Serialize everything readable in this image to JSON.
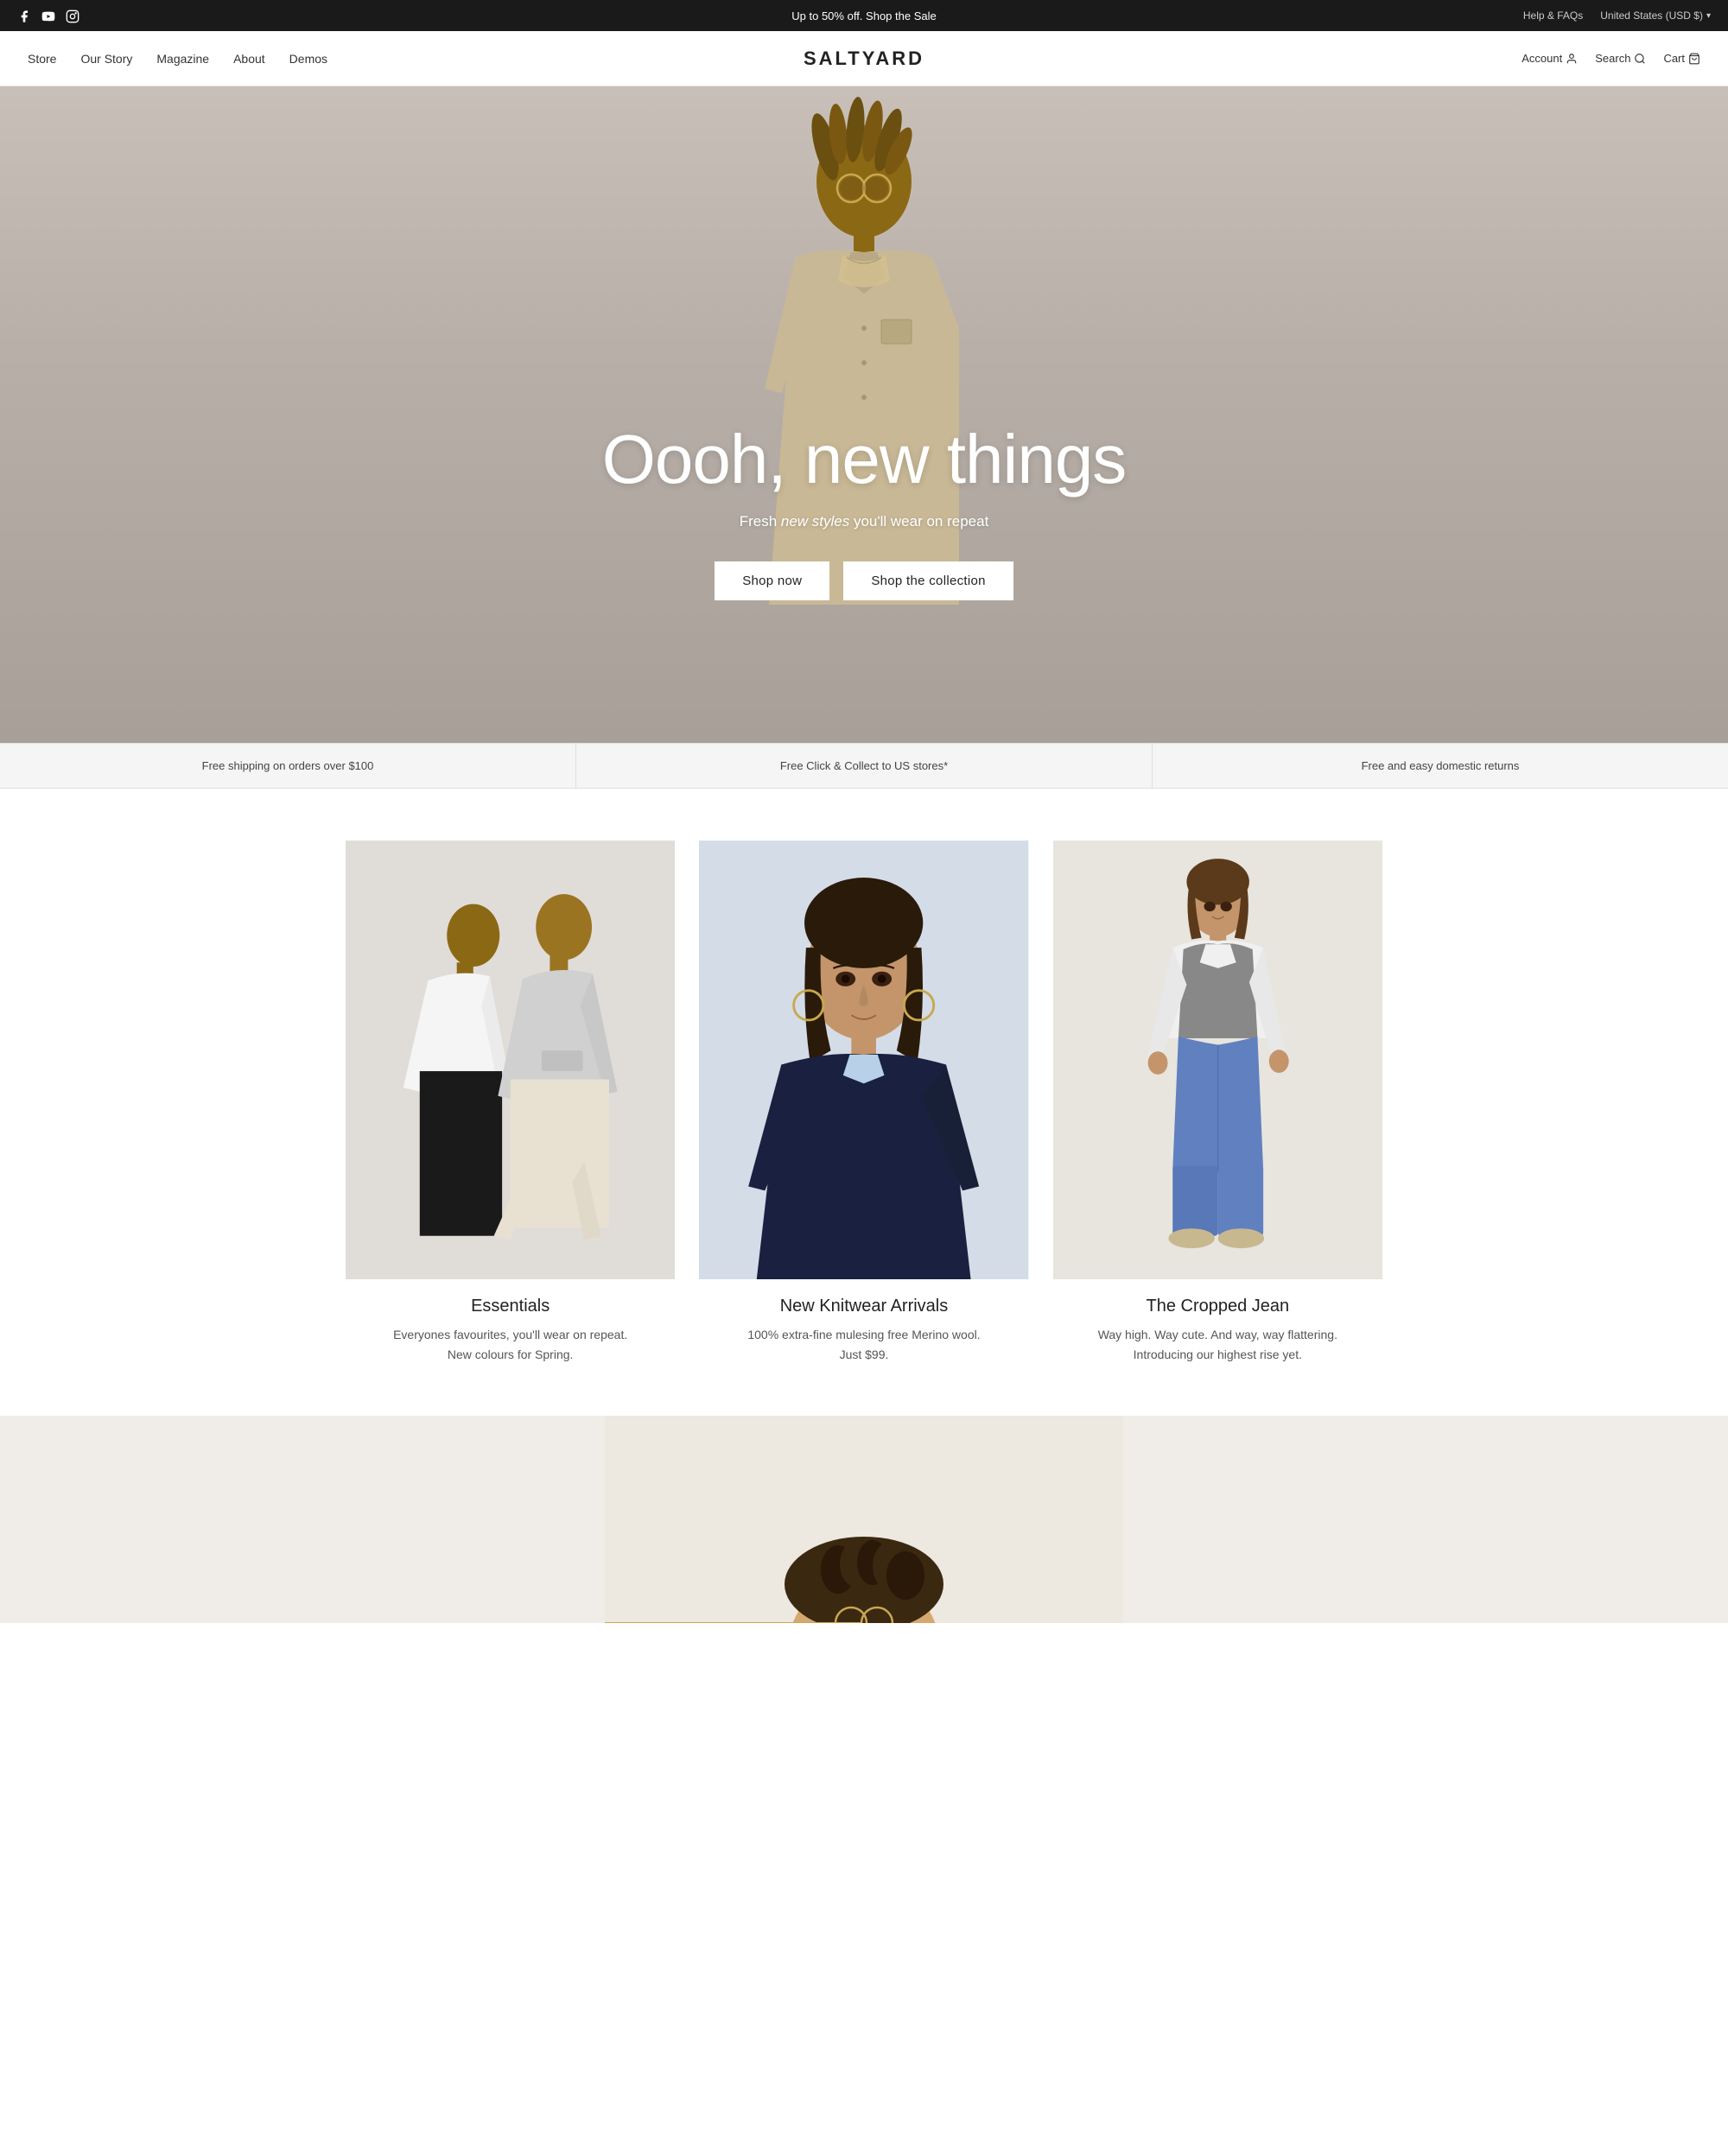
{
  "announcement": {
    "sale_text": "Up to 50% off. ",
    "sale_link": "Shop the Sale",
    "help_link": "Help & FAQs",
    "currency": "United States (USD $)",
    "currency_arrow": "▾"
  },
  "social": {
    "facebook": "f",
    "youtube": "▶",
    "instagram": "◻"
  },
  "nav": {
    "logo": "SALTYARD",
    "left_links": [
      {
        "label": "Store",
        "id": "store"
      },
      {
        "label": "Our Story",
        "id": "our-story"
      },
      {
        "label": "Magazine",
        "id": "magazine"
      },
      {
        "label": "About",
        "id": "about"
      },
      {
        "label": "Demos",
        "id": "demos"
      }
    ],
    "right_links": [
      {
        "label": "Account",
        "id": "account"
      },
      {
        "label": "Search",
        "id": "search"
      },
      {
        "label": "Cart",
        "id": "cart"
      }
    ]
  },
  "hero": {
    "title": "Oooh, new things",
    "subtitle_before": "Fresh ",
    "subtitle_italic": "new styles",
    "subtitle_after": " you'll wear on repeat",
    "btn_shop_now": "Shop now",
    "btn_shop_collection": "Shop the collection"
  },
  "info_bar": [
    {
      "text": "Free shipping on orders over $100"
    },
    {
      "text": "Free Click & Collect to US stores*"
    },
    {
      "text": "Free and easy domestic returns"
    }
  ],
  "products": [
    {
      "name": "Essentials",
      "desc": "Everyones favourites, you'll wear on repeat.\nNew colours for Spring.",
      "bg_top": "#c8c8c8",
      "bg_bottom": "#e8e4e0",
      "figure_color": "#888"
    },
    {
      "name": "New Knitwear Arrivals",
      "desc": "100% extra-fine mulesing free Merino wool.\nJust $99.",
      "bg_top": "#b8c4d0",
      "bg_bottom": "#1a1a2e",
      "figure_color": "#4a5568"
    },
    {
      "name": "The Cropped Jean",
      "desc": "Way high. Way cute. And way, way flattering.\nIntroducing our highest rise yet.",
      "bg_top": "#d8d4cc",
      "bg_bottom": "#e8e4e0",
      "figure_color": "#6b7280"
    }
  ],
  "colors": {
    "hero_bg": "#c0bab2",
    "announcement_bg": "#1a1a1a",
    "nav_border": "#e8e8e8",
    "info_bg": "#f5f5f5"
  }
}
